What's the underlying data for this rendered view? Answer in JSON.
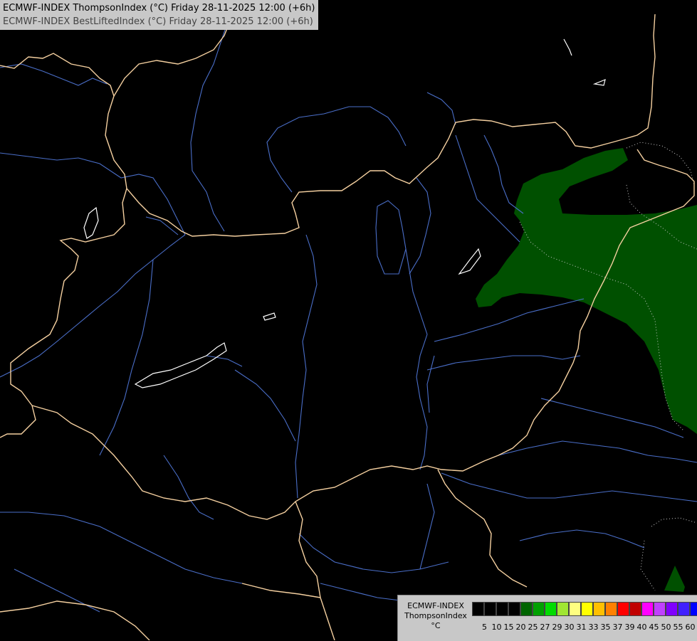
{
  "header": {
    "line1": "ECMWF-INDEX ThompsonIndex (°C) Friday 28-11-2025 12:00 (+6h)",
    "line2": "ECMWF-INDEX BestLiftedIndex (°C) Friday 28-11-2025 12:00 (+6h)"
  },
  "legend": {
    "model": "ECMWF-INDEX",
    "parameter": "ThompsonIndex",
    "unit": "°C",
    "colors": [
      "#000000",
      "#000000",
      "#000000",
      "#000000",
      "#006400",
      "#00a000",
      "#00dc00",
      "#a0e632",
      "#ffff80",
      "#ffff00",
      "#ffc000",
      "#ff8000",
      "#ff0000",
      "#c00000",
      "#ff00ff",
      "#c040ff",
      "#8000ff",
      "#4020ff",
      "#0000ff"
    ],
    "ticks": [
      "5",
      "10",
      "15",
      "20",
      "25",
      "27",
      "29",
      "30",
      "31",
      "33",
      "35",
      "37",
      "39",
      "40",
      "45",
      "50",
      "55",
      "60"
    ]
  },
  "map": {
    "background": "#000000",
    "border_color": "#f5d0a0",
    "river_color": "#4a6ec8",
    "lake_color": "#ffffff",
    "fill_color": "#005000",
    "contour_color": "#c8c8c8"
  }
}
